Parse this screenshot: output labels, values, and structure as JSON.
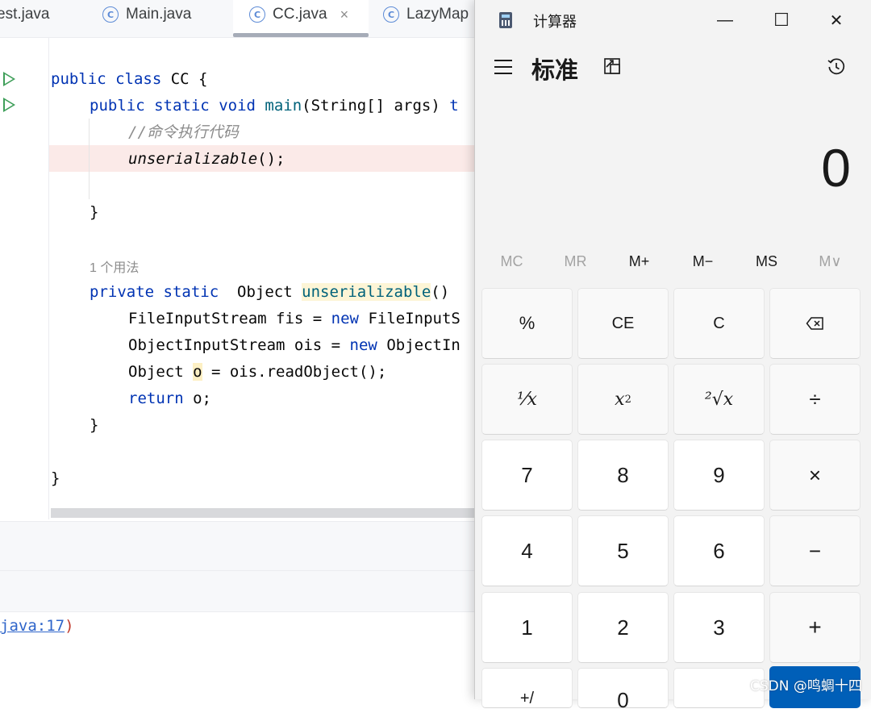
{
  "ide": {
    "tabs": [
      {
        "label": "est.java"
      },
      {
        "label": "Main.java"
      },
      {
        "label": "CC.java",
        "active": true,
        "close": "×"
      },
      {
        "label": "LazyMap"
      }
    ],
    "code": {
      "l1_kw1": "public",
      "l1_kw2": "class",
      "l1_rest": " CC {",
      "l2_kw1": "public",
      "l2_kw2": "static",
      "l2_kw3": "void",
      "l2_fn": "main",
      "l2_rest": "(String[] args) ",
      "l2_tail": "t",
      "l3_comment": "//命令执行代码",
      "l4_call": "unserializable",
      "l4_rest": "();",
      "l6_brace": "}",
      "usage_hint": "1 个用法",
      "l8_kw1": "private",
      "l8_kw2": "static",
      "l8_mid": "  Object ",
      "l8_fn": "unserializable",
      "l8_rest": "()",
      "l9_a": "FileInputStream fis = ",
      "l9_kw": "new",
      "l9_b": " FileInputS",
      "l10_a": "ObjectInputStream ois = ",
      "l10_kw": "new",
      "l10_b": " ObjectIn",
      "l11_a": "Object ",
      "l11_var": "o",
      "l11_b": " = ois.readObject();",
      "l12_kw": "return",
      "l12_b": " o;",
      "l13_brace": "}",
      "l15_brace": "}"
    },
    "console": {
      "link": "java:17",
      "paren": ")"
    }
  },
  "calculator": {
    "title": "计算器",
    "window_buttons": {
      "minimize": "—",
      "maximize": "☐",
      "close": "✕"
    },
    "mode": "标准",
    "display": "0",
    "memory": [
      "MC",
      "MR",
      "M+",
      "M−",
      "MS",
      "M∨"
    ],
    "keys": {
      "percent": "%",
      "ce": "CE",
      "c": "C",
      "backspace": "⌫",
      "reciprocal": "⅟x",
      "square_base": "x",
      "square_exp": "2",
      "sqrt": "²√x",
      "divide": "÷",
      "seven": "7",
      "eight": "8",
      "nine": "9",
      "multiply": "×",
      "four": "4",
      "five": "5",
      "six": "6",
      "minus": "−",
      "one": "1",
      "two": "2",
      "three": "3",
      "plus": "+",
      "negate": "+/",
      "zero": "0"
    }
  },
  "watermark": "CSDN @鸣蜩十四"
}
